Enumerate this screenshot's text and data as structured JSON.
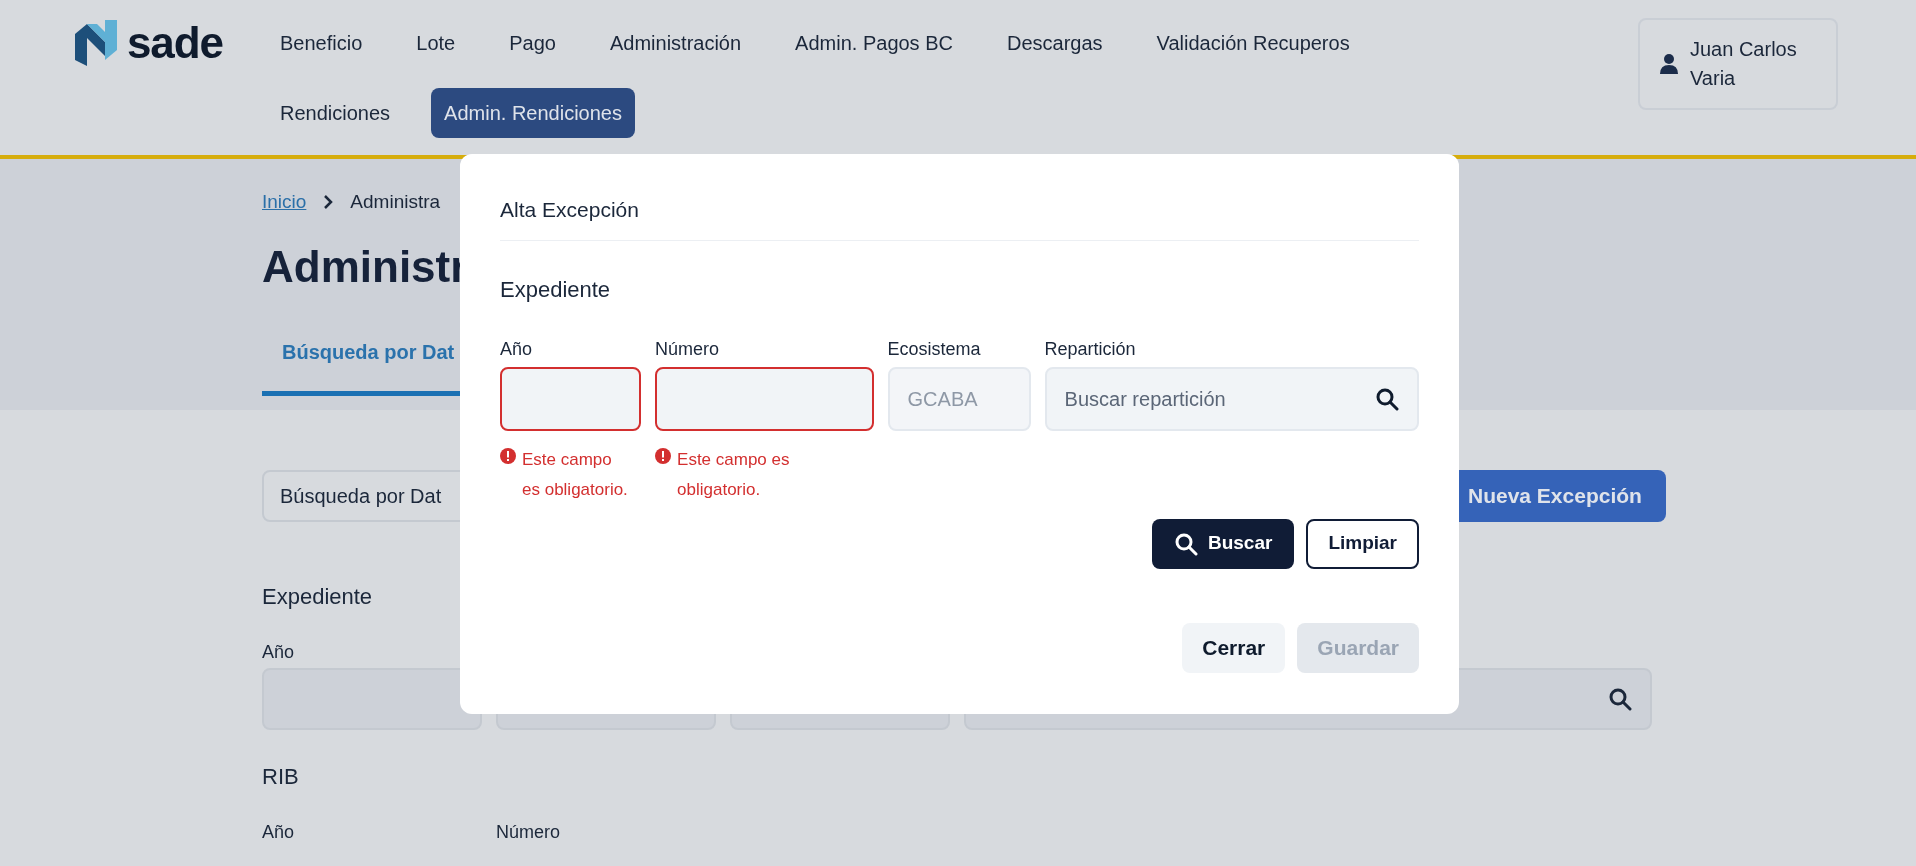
{
  "header": {
    "logo": "sade",
    "nav": [
      {
        "label": "Beneficio",
        "selected": false
      },
      {
        "label": "Lote",
        "selected": false
      },
      {
        "label": "Pago",
        "selected": false
      },
      {
        "label": "Administración",
        "selected": false
      },
      {
        "label": "Admin. Pagos BC",
        "selected": false
      },
      {
        "label": "Descargas",
        "selected": false
      },
      {
        "label": "Validación Recuperos",
        "selected": false
      },
      {
        "label": "Rendiciones",
        "selected": false
      },
      {
        "label": "Admin. Rendiciones",
        "selected": true
      }
    ],
    "user": "Juan Carlos Varia"
  },
  "page": {
    "breadcrumb": [
      {
        "label": "Inicio",
        "kind": "link"
      },
      {
        "label": "Administra",
        "kind": "current"
      }
    ],
    "title": "Administr",
    "tabs": [
      {
        "label": "Búsqueda por Dat",
        "selected": true
      }
    ],
    "search_mode": "Búsqueda por Dat",
    "new_button": "Nueva Excepción",
    "sections": [
      {
        "title": "Expediente",
        "labels": [
          "Año"
        ],
        "fields": [
          {
            "kind": "text"
          },
          {
            "kind": "text"
          },
          {
            "kind": "text"
          },
          {
            "kind": "search"
          }
        ]
      },
      {
        "title": "RIB",
        "labels": [
          "Año",
          "Número"
        ]
      }
    ]
  },
  "modal": {
    "title": "Alta Excepción",
    "section": "Expediente",
    "fields": [
      {
        "label": "Año",
        "kind": "text",
        "invalid": true,
        "disabled": false,
        "error": "Este campo es obligatorio."
      },
      {
        "label": "Número",
        "kind": "text",
        "invalid": true,
        "disabled": false,
        "error": "Este campo es obligatorio."
      },
      {
        "label": "Ecosistema",
        "kind": "text",
        "invalid": false,
        "disabled": true,
        "placeholder": "GCABA"
      },
      {
        "label": "Repartición",
        "kind": "search",
        "invalid": false,
        "disabled": false,
        "placeholder": "Buscar repartición"
      }
    ],
    "actions": [
      {
        "label": "Buscar",
        "kind": "primary"
      },
      {
        "label": "Limpiar",
        "kind": "outline"
      }
    ],
    "footer": [
      {
        "label": "Cerrar",
        "disabled": false
      },
      {
        "label": "Guardar",
        "disabled": true
      }
    ]
  }
}
